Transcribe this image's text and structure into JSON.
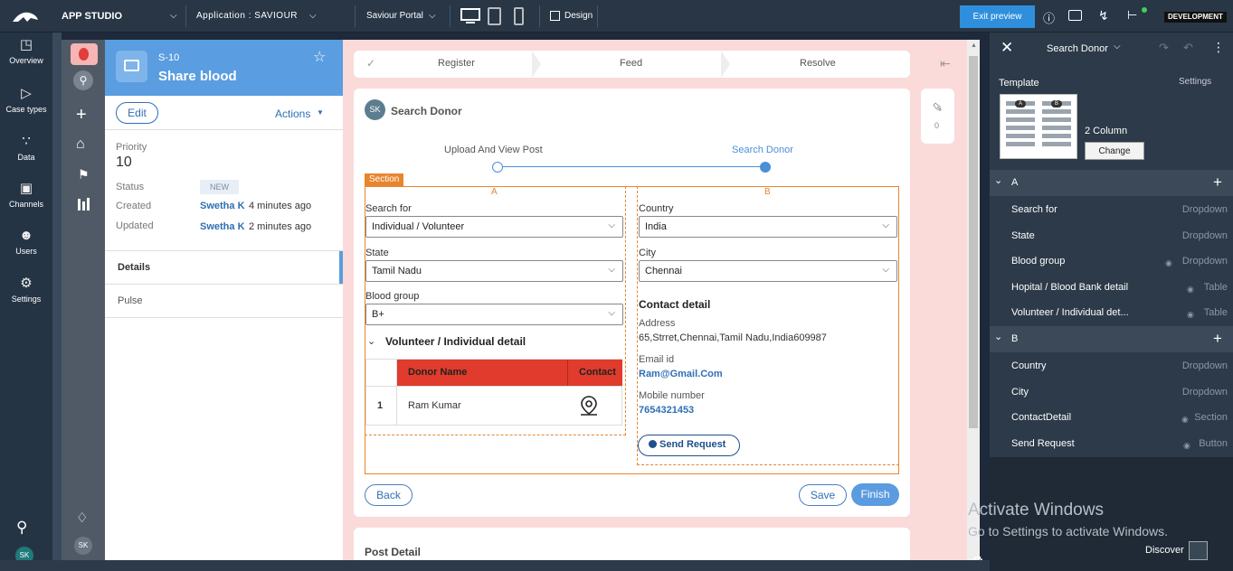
{
  "topbar": {
    "app": "APP STUDIO",
    "application": "Application : SAVIOUR",
    "portal": "Saviour Portal",
    "design": "Design",
    "exit_preview": "Exit preview",
    "env": "DEVELOPMENT"
  },
  "leftnav": [
    {
      "label": "Overview",
      "icon": "dashboard-icon"
    },
    {
      "label": "Case types",
      "icon": "case-types-icon"
    },
    {
      "label": "Data",
      "icon": "data-icon"
    },
    {
      "label": "Channels",
      "icon": "channels-icon"
    },
    {
      "label": "Users",
      "icon": "users-icon"
    },
    {
      "label": "Settings",
      "icon": "gear-icon"
    }
  ],
  "user_initials": "SK",
  "case": {
    "id": "S-10",
    "title": "Share blood",
    "edit": "Edit",
    "actions": "Actions",
    "priority_label": "Priority",
    "priority": "10",
    "status_label": "Status",
    "status": "NEW",
    "created_label": "Created",
    "created_by": "Swetha K",
    "created_ago": "4 minutes ago",
    "updated_label": "Updated",
    "updated_by": "Swetha K",
    "updated_ago": "2 minutes ago",
    "tabs": [
      "Details",
      "Pulse"
    ]
  },
  "stages": [
    "Register",
    "Feed",
    "Resolve"
  ],
  "attach_count": "0",
  "form": {
    "initials": "SK",
    "title": "Search Donor",
    "steps": [
      "Upload And View Post",
      "Search Donor"
    ],
    "section_tag": "Section",
    "col_a": "A",
    "col_b": "B",
    "search_for_label": "Search for",
    "search_for": "Individual / Volunteer",
    "state_label": "State",
    "state": "Tamil Nadu",
    "blood_group_label": "Blood group",
    "blood_group": "B+",
    "vol_title": "Volunteer / Individual detail",
    "table": {
      "headers": [
        "Donor Name",
        "Contact"
      ],
      "rows": [
        {
          "n": "1",
          "name": "Ram Kumar"
        }
      ]
    },
    "country_label": "Country",
    "country": "India",
    "city_label": "City",
    "city": "Chennai",
    "contact_title": "Contact detail",
    "address_label": "Address",
    "address": "65,Strret,Chennai,Tamil Nadu,India609987",
    "email_label": "Email id",
    "email": "Ram@Gmail.Com",
    "mobile_label": "Mobile number",
    "mobile": "7654321453",
    "send_request": "Send Request",
    "back": "Back",
    "save": "Save",
    "finish": "Finish"
  },
  "post_detail": "Post Detail",
  "rpanel": {
    "title": "Search Donor",
    "template": "Template",
    "settings": "Settings",
    "layout": "2 Column",
    "change": "Change",
    "groups": [
      {
        "name": "A",
        "items": [
          {
            "l": "Search for",
            "r": "Dropdown"
          },
          {
            "l": "State",
            "r": "Dropdown"
          },
          {
            "l": "Blood group",
            "r": "Dropdown"
          },
          {
            "l": "Hopital / Blood Bank detail",
            "r": "Table"
          },
          {
            "l": "Volunteer / Individual det...",
            "r": "Table"
          }
        ]
      },
      {
        "name": "B",
        "items": [
          {
            "l": "Country",
            "r": "Dropdown"
          },
          {
            "l": "City",
            "r": "Dropdown"
          },
          {
            "l": "ContactDetail",
            "r": "Section"
          },
          {
            "l": "Send Request",
            "r": "Button"
          }
        ]
      }
    ]
  },
  "watermark": {
    "line1": "Activate Windows",
    "line2": "Go to Settings to activate Windows."
  },
  "discover": "Discover"
}
